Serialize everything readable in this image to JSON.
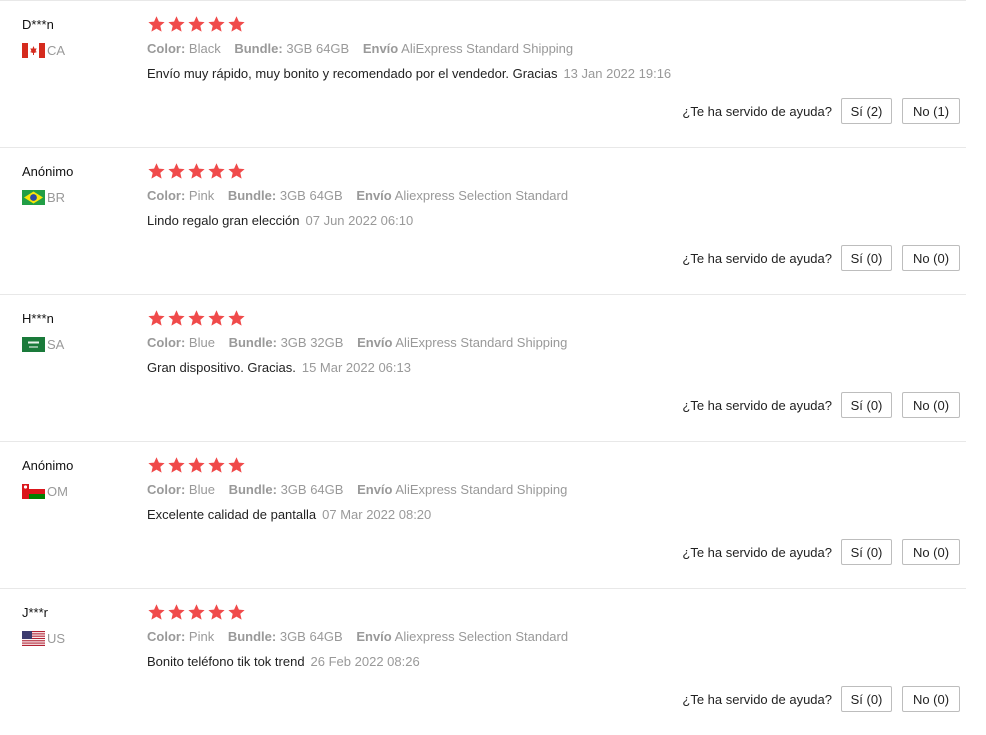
{
  "helpful_question": "¿Te ha servido de ayuda?",
  "labels": {
    "color": "Color:",
    "bundle": "Bundle:",
    "shipping": "Envío"
  },
  "colors": {
    "star": "#f04a4a",
    "muted": "#999999"
  },
  "reviews": [
    {
      "user": "D***n",
      "country": "CA",
      "flag_icon": "canada-flag-icon",
      "rating": 5,
      "color": "Black",
      "bundle": "3GB 64GB",
      "shipping": "AliExpress Standard Shipping",
      "text": "Envío muy rápido, muy bonito y recomendado por el vendedor. Gracias",
      "date": "13 Jan 2022 19:16",
      "yes": "Sí (2)",
      "no": "No (1)"
    },
    {
      "user": "Anónimo",
      "country": "BR",
      "flag_icon": "brazil-flag-icon",
      "rating": 5,
      "color": "Pink",
      "bundle": "3GB 64GB",
      "shipping": "Aliexpress Selection Standard",
      "text": "Lindo regalo gran elección",
      "date": "07 Jun 2022 06:10",
      "yes": "Sí (0)",
      "no": "No (0)"
    },
    {
      "user": "H***n",
      "country": "SA",
      "flag_icon": "saudi-arabia-flag-icon",
      "rating": 5,
      "color": "Blue",
      "bundle": "3GB 32GB",
      "shipping": "AliExpress Standard Shipping",
      "text": "Gran dispositivo. Gracias.",
      "date": "15 Mar 2022 06:13",
      "yes": "Sí (0)",
      "no": "No (0)"
    },
    {
      "user": "Anónimo",
      "country": "OM",
      "flag_icon": "oman-flag-icon",
      "rating": 5,
      "color": "Blue",
      "bundle": "3GB 64GB",
      "shipping": "AliExpress Standard Shipping",
      "text": "Excelente calidad de pantalla",
      "date": "07 Mar 2022 08:20",
      "yes": "Sí (0)",
      "no": "No (0)"
    },
    {
      "user": "J***r",
      "country": "US",
      "flag_icon": "usa-flag-icon",
      "rating": 5,
      "color": "Pink",
      "bundle": "3GB 64GB",
      "shipping": "Aliexpress Selection Standard",
      "text": "Bonito teléfono tik tok trend",
      "date": "26 Feb 2022 08:26",
      "yes": "Sí (0)",
      "no": "No (0)"
    }
  ]
}
